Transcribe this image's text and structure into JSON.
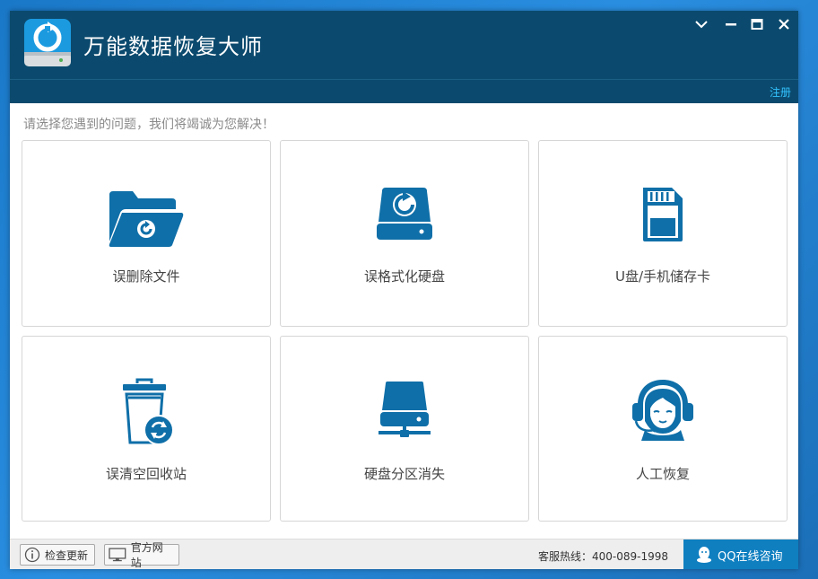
{
  "app": {
    "title": "万能数据恢复大师",
    "register_label": "注册"
  },
  "main": {
    "prompt": "请选择您遇到的问题，我们将竭诚为您解决！",
    "tiles": [
      {
        "label": "误删除文件",
        "icon": "folder-recover-icon"
      },
      {
        "label": "误格式化硬盘",
        "icon": "disk-format-icon"
      },
      {
        "label": "U盘/手机储存卡",
        "icon": "sd-card-icon"
      },
      {
        "label": "误清空回收站",
        "icon": "recycle-bin-icon"
      },
      {
        "label": "硬盘分区消失",
        "icon": "disk-partition-icon"
      },
      {
        "label": "人工恢复",
        "icon": "customer-service-icon"
      }
    ]
  },
  "footer": {
    "check_update_label": "检查更新",
    "website_label": "官方网站",
    "hotline": "客服热线：400-089-1998",
    "qq_label": "QQ在线咨询"
  },
  "colors": {
    "titlebar": "#0b4a6e",
    "accent": "#0f6fa8",
    "link": "#33c3ff",
    "desktop": "#1a78c8"
  }
}
